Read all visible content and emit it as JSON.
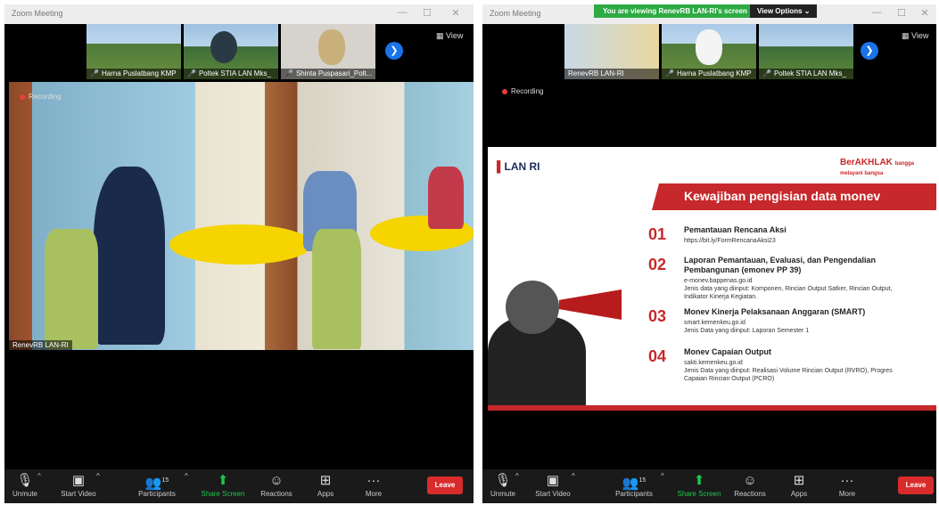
{
  "left": {
    "title": "Zoom Meeting",
    "participants": [
      {
        "name": "Harna Puslatbang KMP"
      },
      {
        "name": "Poltek STIA LAN Mks_"
      },
      {
        "name": "Shinta Puspasari_Polt..."
      }
    ],
    "view_label": "View",
    "recording_label": "Recording",
    "main_video_name": "RenevRB LAN-RI"
  },
  "right": {
    "title": "Zoom Meeting",
    "share_banner": "You are viewing RenevRB LAN-RI's screen",
    "view_options": "View Options",
    "participants": [
      {
        "name": "RenevRB LAN-RI"
      },
      {
        "name": "Harna Puslatbang KMP"
      },
      {
        "name": "Poltek STIA LAN Mks_"
      }
    ],
    "view_label": "View",
    "recording_label": "Recording",
    "slide": {
      "logo_left": "LAN RI",
      "logo_right": "BerAKHLAK",
      "logo_right_tag": "bangga melayani bangsa",
      "header": "Kewajiban pengisian data monev",
      "items": [
        {
          "num": "01",
          "title": "Pemantauan Rencana Aksi",
          "lines": [
            "https://bit.ly/FormRencanaAksi23"
          ]
        },
        {
          "num": "02",
          "title": "Laporan Pemantauan, Evaluasi, dan Pengendalian Pembangunan (emonev PP 39)",
          "lines": [
            "e-monev.bappenas.go.id",
            "Jenis data yang diinput: Komponen, Rincian Output Satker, Rincian Output, Indikator Kinerja Kegiatan."
          ]
        },
        {
          "num": "03",
          "title": "Monev Kinerja Pelaksanaan Anggaran (SMART)",
          "lines": [
            "smart.kemenkeu.go.id",
            "Jenis Data yang diinput: Laporan Semester 1"
          ]
        },
        {
          "num": "04",
          "title": "Monev Capaian Output",
          "lines": [
            "sakti.kemenkeu.go.id",
            "Jenis Data yang diinput: Realisasi Volume Rincian Output (RVRO), Progres Capaian Rincian Output (PCRO)"
          ]
        }
      ]
    }
  },
  "toolbar": {
    "unmute": "Unmute",
    "start_video": "Start Video",
    "participants": "Participants",
    "participants_count": "15",
    "share_screen": "Share Screen",
    "reactions": "Reactions",
    "apps": "Apps",
    "more": "More",
    "leave": "Leave"
  }
}
